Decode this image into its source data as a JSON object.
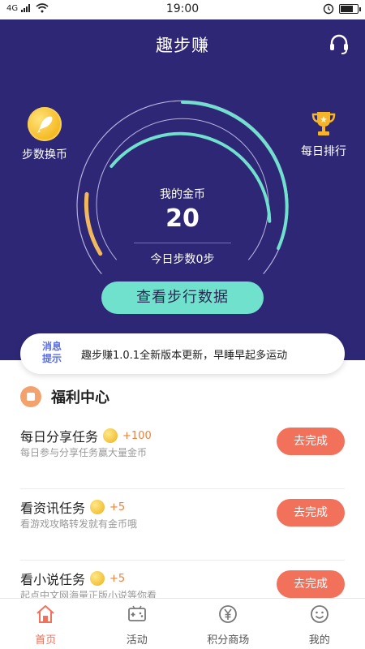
{
  "status_bar": {
    "signal": "4G",
    "time": "19:00"
  },
  "app": {
    "title": "趣步赚"
  },
  "side_buttons": {
    "left_label": "步数换币",
    "right_label": "每日排行"
  },
  "gauge": {
    "coin_label": "我的金币",
    "coin_value": "20",
    "steps_label": "今日步数0步"
  },
  "view_button": {
    "label": "查看步行数据"
  },
  "notice": {
    "tag": "消息提示",
    "text": "趣步赚1.0.1全新版本更新，早睡早起多运动"
  },
  "welfare": {
    "title": "福利中心"
  },
  "tasks": [
    {
      "title": "每日分享任务",
      "reward": "+100",
      "desc": "每日参与分享任务赢大量金币",
      "button": "去完成"
    },
    {
      "title": "看资讯任务",
      "reward": "+5",
      "desc": "看游戏攻略转发就有金币哦",
      "button": "去完成"
    },
    {
      "title": "看小说任务",
      "reward": "+5",
      "desc": "起点中文网海量正版小说等你看",
      "button": "去完成"
    }
  ],
  "tabbar": [
    {
      "label": "首页",
      "icon": "home-icon",
      "active": true
    },
    {
      "label": "活动",
      "icon": "gamepad-icon",
      "active": false
    },
    {
      "label": "积分商场",
      "icon": "yen-coin-icon",
      "active": false
    },
    {
      "label": "我的",
      "icon": "smiley-icon",
      "active": false
    }
  ],
  "colors": {
    "hero_bg": "#2e2776",
    "accent_teal": "#70e1cd",
    "accent_orange": "#f2715b",
    "gauge_orange": "#f1b860"
  }
}
